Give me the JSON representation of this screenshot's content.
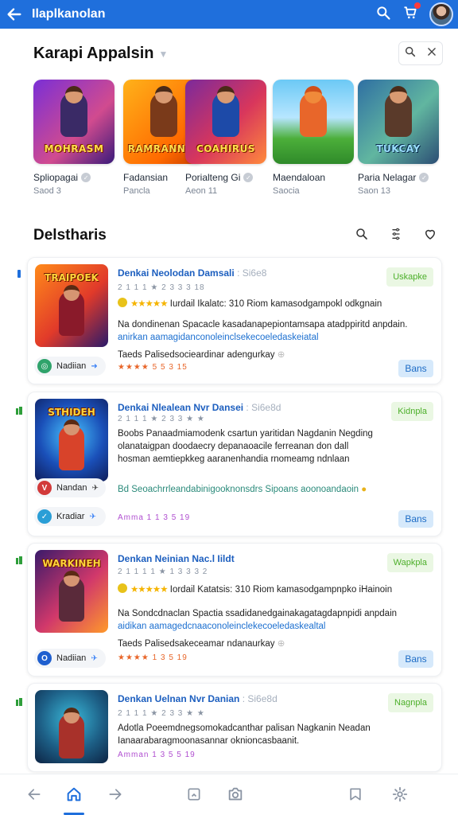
{
  "app": {
    "title": "Ilaplkanolan",
    "accent": "#1f6fdc"
  },
  "header": {
    "title": "Karapi Appalsin",
    "search_icon": "search-icon",
    "close_icon": "close-icon"
  },
  "featured": [
    {
      "name": "Spliopagai",
      "sub": "Saod 3",
      "logo": "MOHRASM",
      "bg": "linear-gradient(135deg,#7a2fd6,#d14b8f 60%,#3a1a7a)"
    },
    {
      "name": "Fadansian",
      "sub": "Pancla",
      "logo": "RAMRANNAL",
      "bg": "linear-gradient(135deg,#ffb21a,#ff6a00 70%,#c23b00)"
    },
    {
      "name": "Porialteng Gi",
      "sub": "Aeon 11",
      "logo": "COAHIRUS",
      "bg": "linear-gradient(135deg,#7b2a9c,#d8365c 55%,#ff8a3c)"
    },
    {
      "name": "Maendaloan",
      "sub": "Saocia",
      "logo": "",
      "bg": "linear-gradient(180deg,#6cc9f5,#b7e6ff 45%,#4caf3a 70%,#2f8a2a)"
    },
    {
      "name": "Paria Nelagar",
      "sub": "Saon 13",
      "logo": "TUKCAY",
      "bg": "linear-gradient(135deg,#2f6fa3,#61b6a0 55%,#2b4d74)"
    }
  ],
  "section": {
    "title": "Delstharis"
  },
  "cards": [
    {
      "title": "Denkai Neolodan Damsali",
      "title_dim": ": Si6e8",
      "meta": "2 1 1 1 ★ 2 3 3 3 18",
      "line1_prefix": "★★★★★",
      "line1": " Iurdail Ikalatc: 310 Riom kamasodgampokl odkgnain",
      "line2": "Na dondinenan Spacacle kasadanapepiontamsapa atadppiritd anpdain.",
      "line3": "anirkan aamagidanconoleinclsekecoeledaskeiatal",
      "line4": "Taeds Palisedsocieardinar adengurkay",
      "pill": "Nadiian",
      "rating": "★★★★ 5 5 3 15",
      "tag": "Uskapke",
      "button": "Bans",
      "logo": "TRAIPOEK",
      "bg": "linear-gradient(135deg,#ff8a1a,#e13a2a 55%,#2a1a6a)"
    },
    {
      "title": "Denkai Nlealean Nvr Dansei",
      "title_dim": ": Si6e8d",
      "meta": "2 1 1 1 ★ 2 3 3 ★ ★",
      "line1_prefix": "",
      "line1": "Boobs Panaadmiamodenk csartun yaritidan Nagdanin Negding",
      "line2": "olanataigpan doodaecry depanaoacile ferreanan don dall",
      "line3": "hosman aemtiepkkeg aaranenhandia rnomeamg ndnlaan",
      "line4": "Bd Seoachrrleandabinigooknonsdrs Sipoans aoonoandaoin",
      "pill": "Nandan",
      "pill2": "Kradiar",
      "rating": "Amma 1 1 3 5 19",
      "tag": "Kidnpla",
      "button": "Bans",
      "logo": "STHIDEH",
      "bg": "radial-gradient(circle at 50% 45%,#49c6ff,#1a4fb8 55%,#0f1d5a)"
    },
    {
      "title": "Denkan Neinian Nac.l Iildt",
      "title_dim": "",
      "meta": "2 1 1 1 1 ★ 1 3 3 3 2",
      "line1_prefix": "★★★★★",
      "line1": " Iordail Katatsis: 310 Riom kamasodgampnpko iHainoin",
      "line2": "Na Sondcdnaclan Spactia ssadidanedgainakagatagdapnpidi anpdain",
      "line3": "aidikan aamagedcnaaconoleinclekecoeledaskealtal",
      "line4": "Taeds Palisedsakeceamar ndanaurkay",
      "pill": "Nadiian",
      "rating": "★★★★ 1 3 5 19",
      "tag": "Wapkpla",
      "button": "Bans",
      "logo": "WARKINEH",
      "bg": "linear-gradient(135deg,#3a1a6a,#d1386b 55%,#ff9a2a)"
    },
    {
      "title": "Denkan Uelnan Nvr Danian",
      "title_dim": ": Si6e8d",
      "meta": "2 1 1 1 ★ 2 3 3 ★ ★",
      "line1_prefix": "",
      "line1": "Adotla Poeemdnegsomokadcanthar palisan Nagkanin Neadan",
      "line2": "Ianaarabaragmoonasannar oknioncasbaanit.",
      "line3": "",
      "line4": "",
      "pill": "",
      "rating": "Amman 1 3 5 5 19",
      "tag": "Nagnpla",
      "button": "",
      "logo": "",
      "bg": "radial-gradient(circle at 50% 40%,#3ab9d9,#1d5f86 55%,#0d2444)"
    }
  ],
  "bottom_nav": [
    "back-icon",
    "home-icon",
    "forward-icon",
    "library-icon",
    "camera-icon",
    "bookmark-icon",
    "settings-icon"
  ]
}
